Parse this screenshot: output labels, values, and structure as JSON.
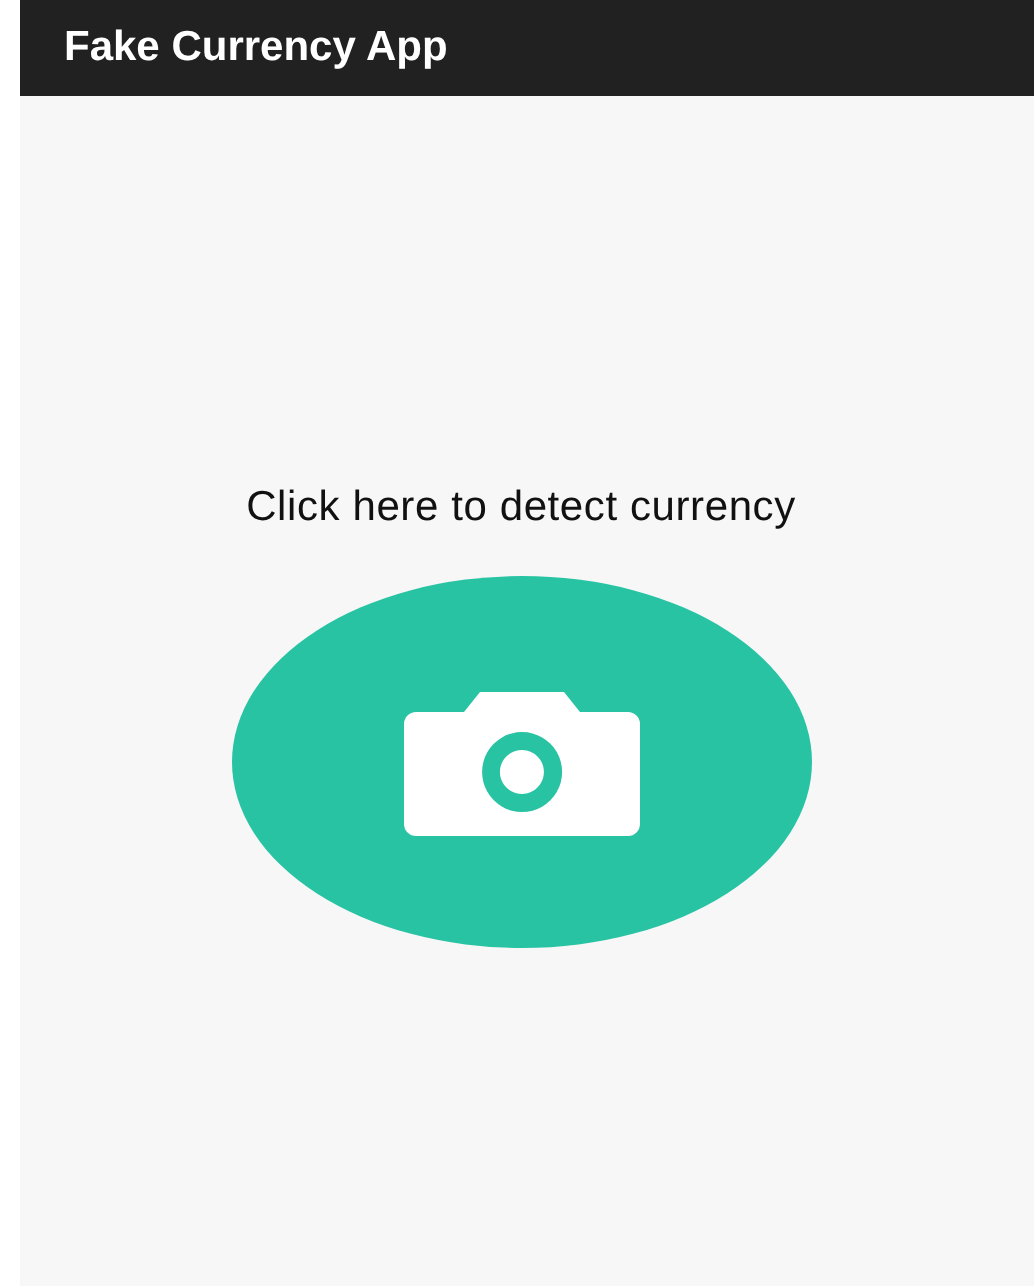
{
  "app_bar": {
    "title": "Fake Currency App"
  },
  "prompt": "Click here to detect currency"
}
